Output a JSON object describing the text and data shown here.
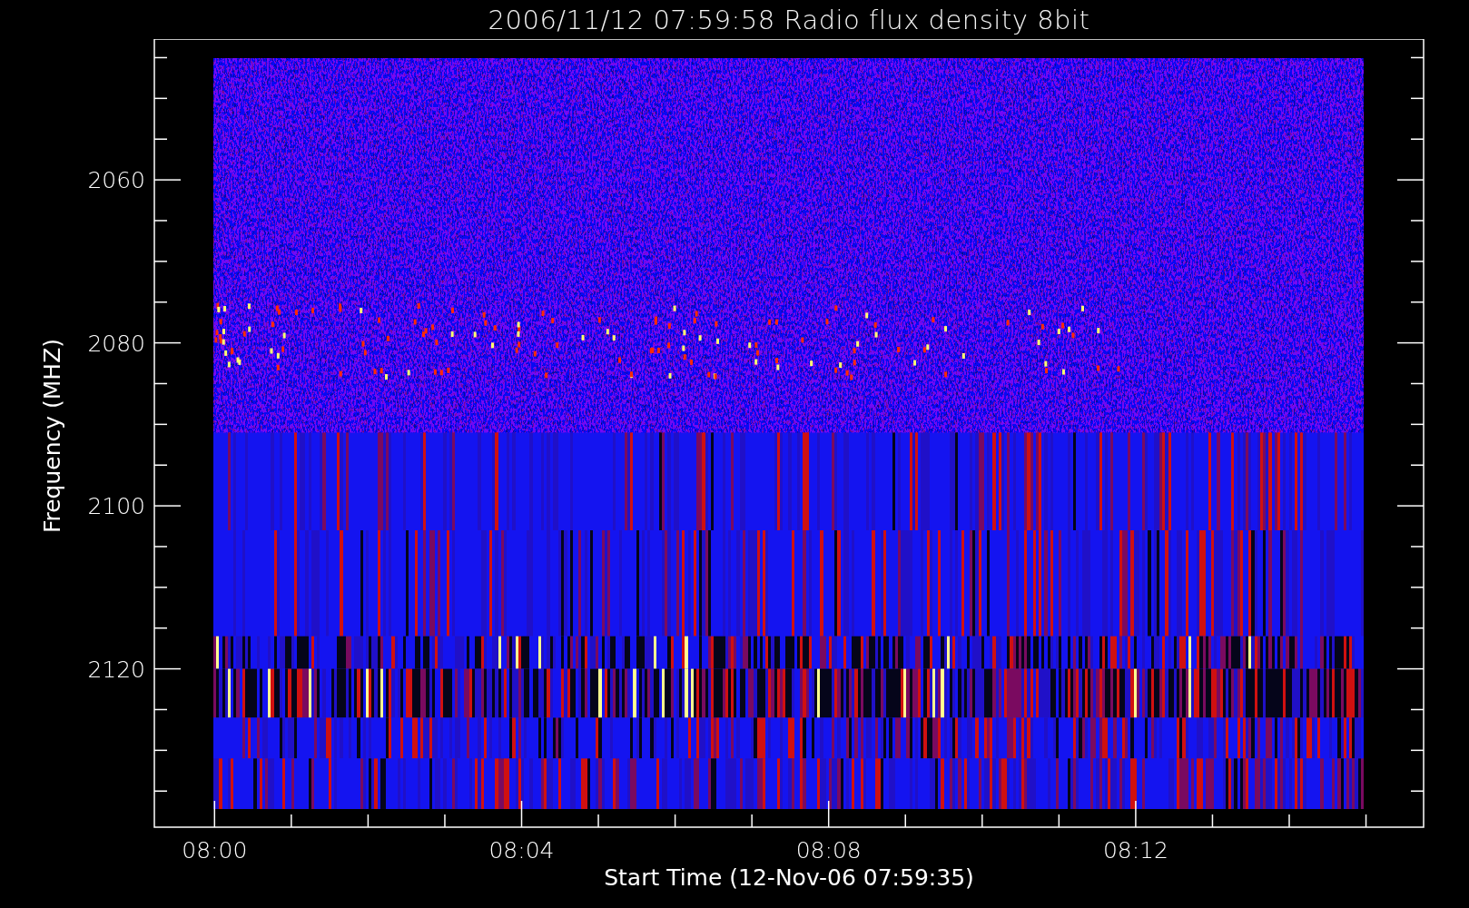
{
  "title": "2006/11/12 07:59:58 Radio flux density 8bit",
  "y_axis": {
    "label": "Frequency (MHZ)",
    "ticks": [
      "2060",
      "2080",
      "2100",
      "2120"
    ]
  },
  "x_axis": {
    "label": "Start Time (12-Nov-06 07:59:35)",
    "ticks": [
      "08:00",
      "08:04",
      "08:08",
      "08:12"
    ]
  }
}
